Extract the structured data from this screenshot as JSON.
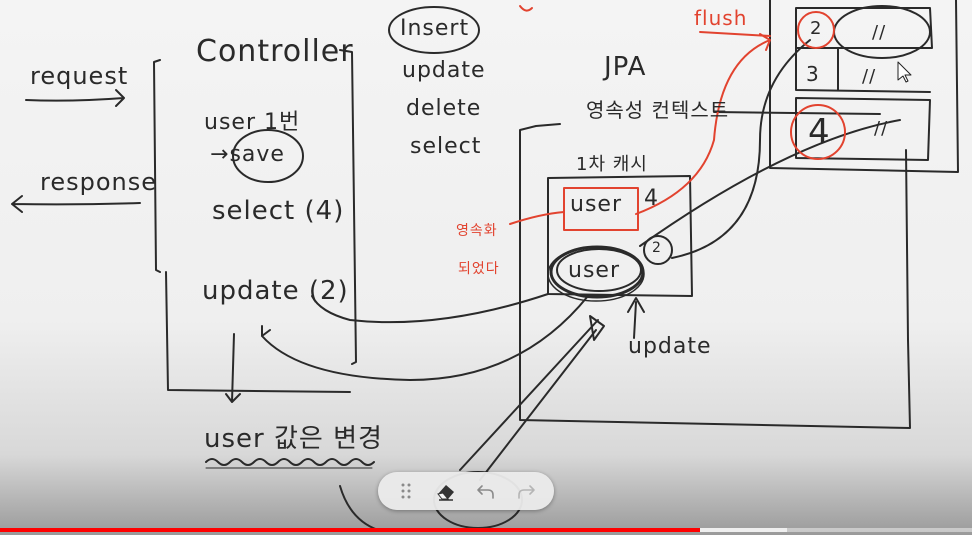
{
  "whiteboard": {
    "left": {
      "request": "request",
      "response": "response"
    },
    "controller": {
      "title": "Controller",
      "line1": "user 1번",
      "line2": "save",
      "line3": "select (4)",
      "line4": "update (2)",
      "bottom_note": "user 값은 변경"
    },
    "operations": [
      "Insert",
      "update",
      "delete",
      "select"
    ],
    "jpa": {
      "title": "JPA",
      "subtitle": "영속성 컨텍스트",
      "cache_label": "1차 캐시",
      "cache_number": "4",
      "entity_top": "user",
      "entity_bottom": "user",
      "marker_2": "2",
      "update_label": "update",
      "red_note_1": "영속화",
      "red_note_2": "되었다"
    },
    "flush": "flush",
    "db_table": {
      "rows": [
        {
          "id": "2",
          "value": "//"
        },
        {
          "id": "3",
          "value": "//"
        },
        {
          "id": "4",
          "value": "//"
        }
      ]
    }
  },
  "toolbar": {
    "icons": [
      "drag-handle-icon",
      "eraser-icon",
      "undo-icon",
      "redo-icon"
    ]
  },
  "video": {
    "played_fraction": 0.72,
    "buffered_fraction": 0.81,
    "accent": "#ff0000"
  },
  "colors": {
    "ink": "#2a2a2a",
    "red_ink": "#e2432f"
  }
}
